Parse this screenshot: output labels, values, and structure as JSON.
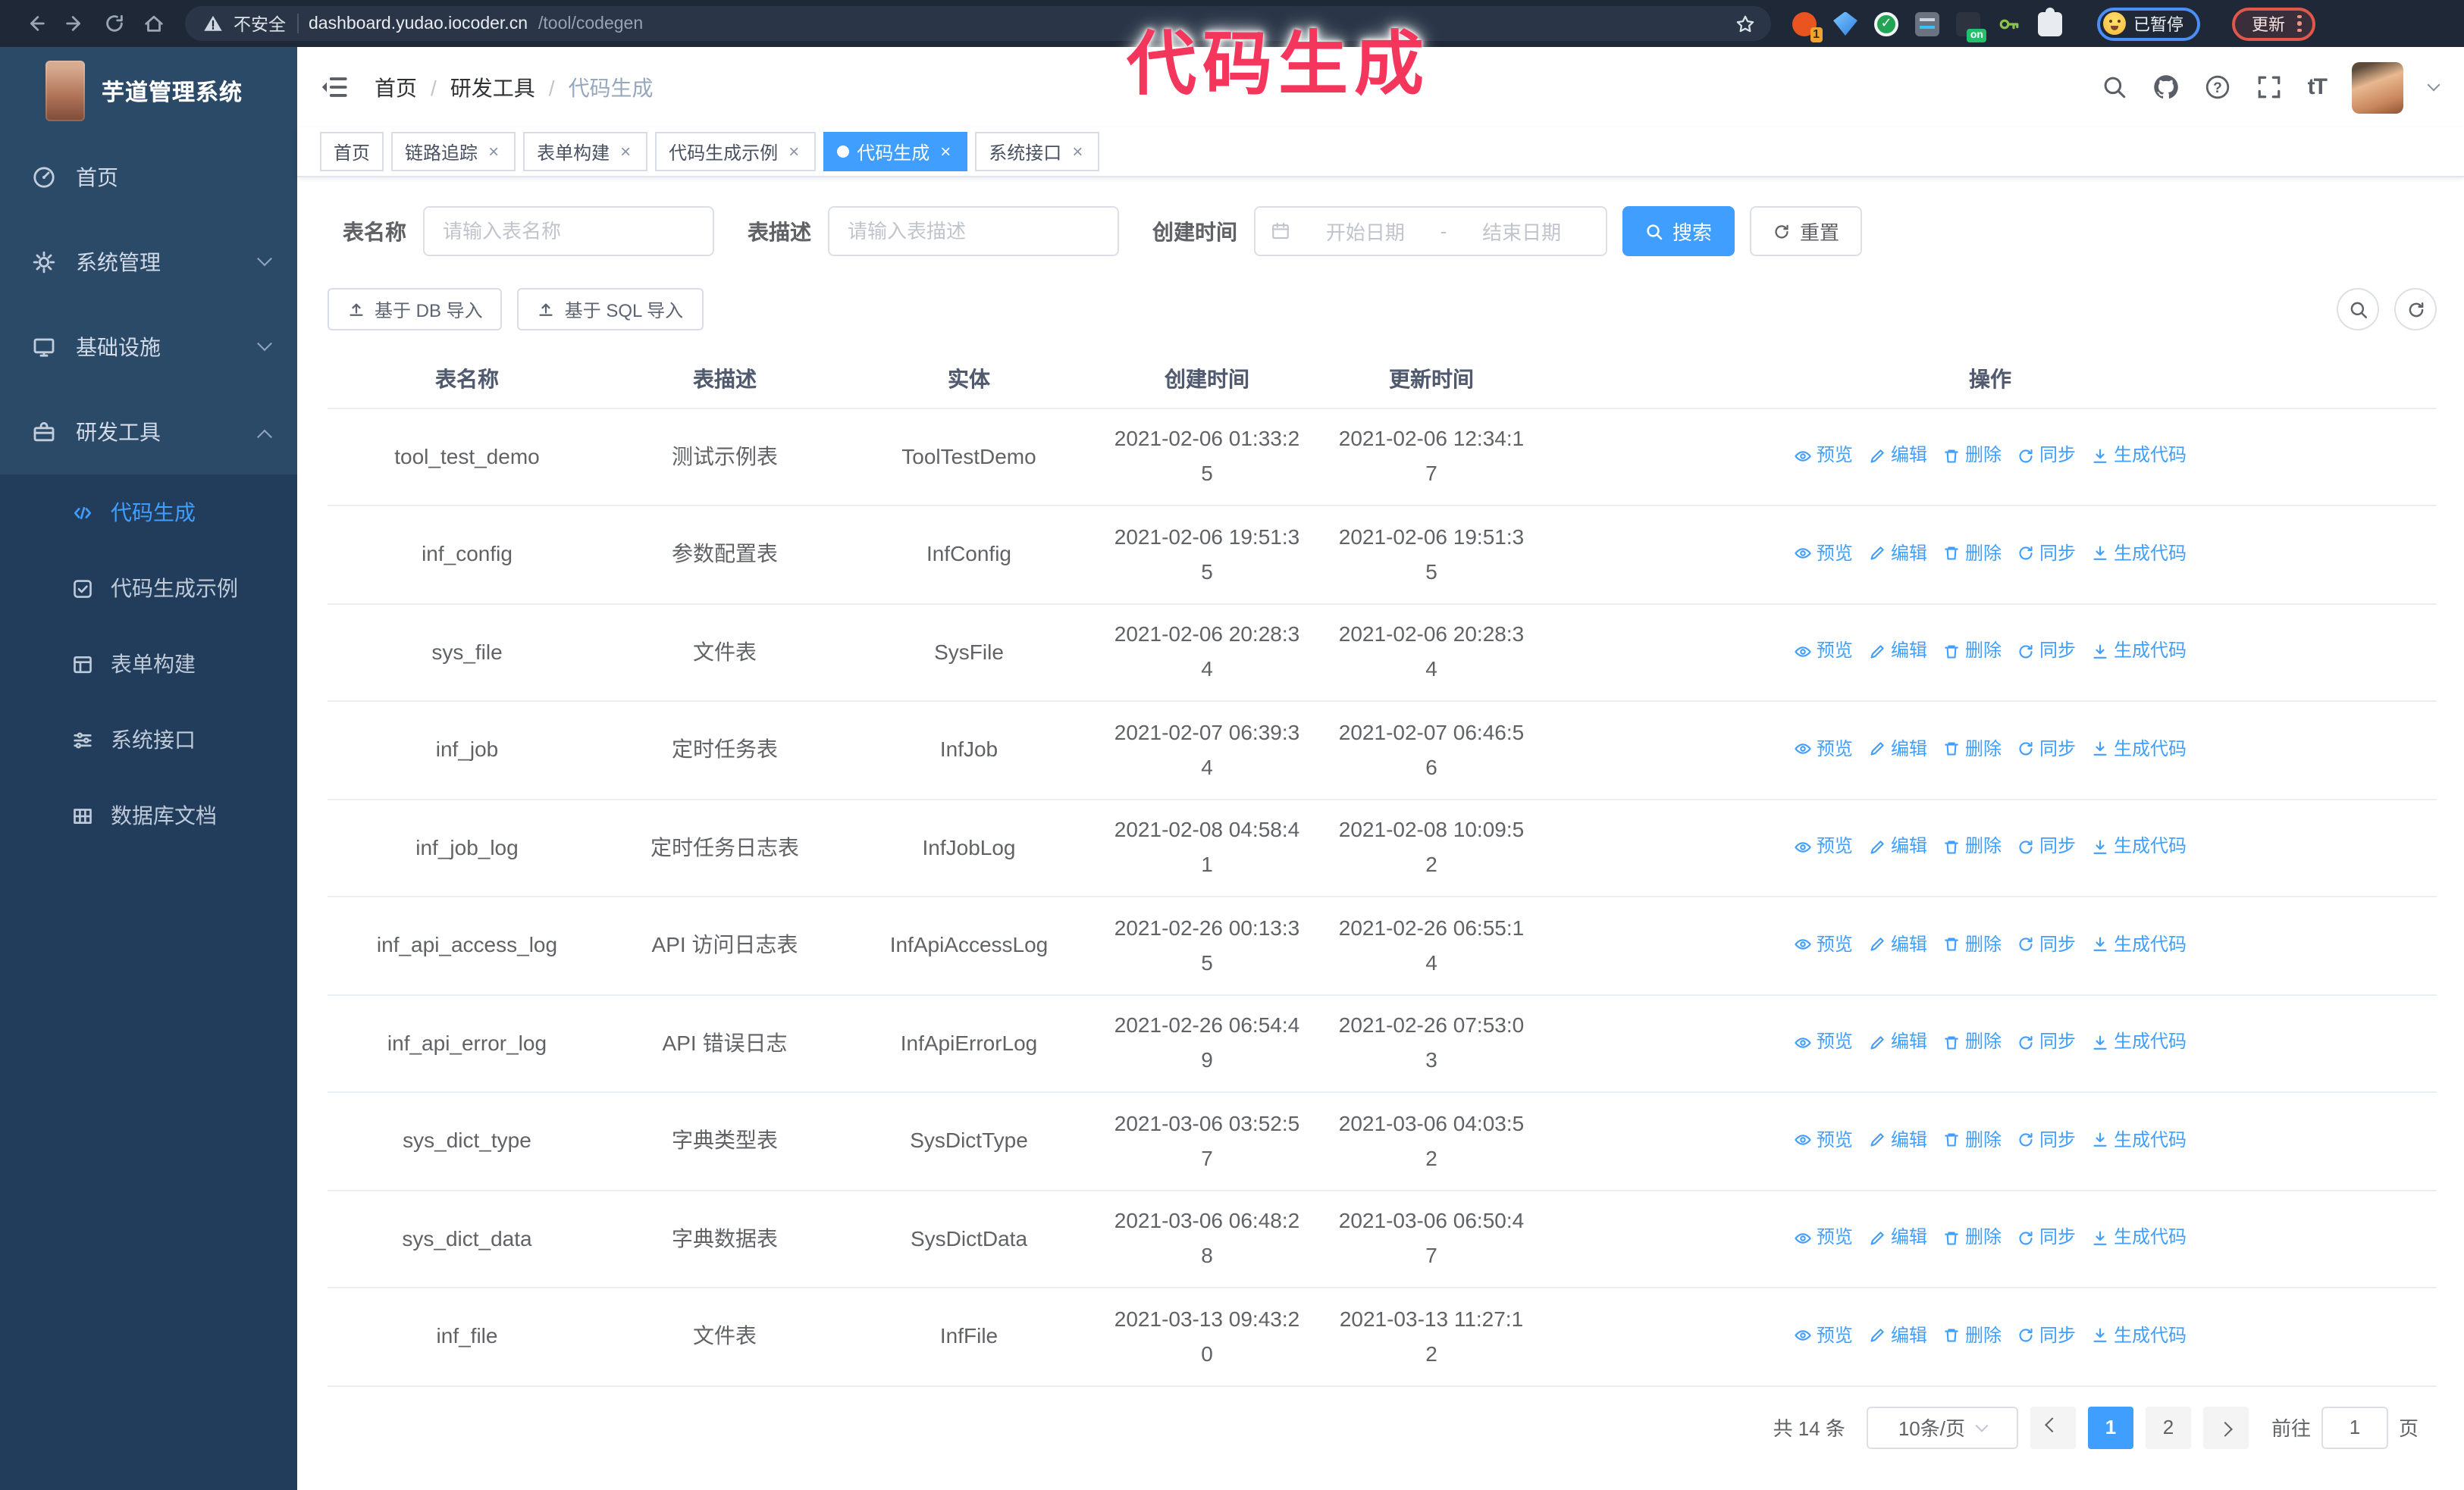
{
  "colors": {
    "accent": "#409eff",
    "annotation": "#f5365c",
    "sidebar_bg": "#2b4a68",
    "submenu_bg": "#223c5b",
    "chrome_bg": "#1e2836",
    "chrome_pill_bg": "#2a3647",
    "update_border": "#e2574c",
    "paused_border": "#4b8ef7"
  },
  "annotation": {
    "text": "代码生成"
  },
  "browser": {
    "security_label": "不安全",
    "url_host": "dashboard.yudao.iocoder.cn",
    "url_path": "/tool/codegen",
    "extension_badge": "1",
    "extension_on_badge": "on",
    "extension_check_glyph": "✓",
    "paused_chip": "已暂停",
    "update_button": "更新"
  },
  "sidebar": {
    "title": "芋道管理系统",
    "items": [
      {
        "id": "home",
        "label": "首页",
        "icon": "dashboard-icon",
        "chevron": null
      },
      {
        "id": "system",
        "label": "系统管理",
        "icon": "gear-icon",
        "chevron": "down"
      },
      {
        "id": "infra",
        "label": "基础设施",
        "icon": "monitor-icon",
        "chevron": "down"
      },
      {
        "id": "devtools",
        "label": "研发工具",
        "icon": "toolbox-icon",
        "chevron": "up"
      }
    ],
    "submenu": [
      {
        "id": "codegen",
        "label": "代码生成",
        "icon": "code-icon",
        "active": true
      },
      {
        "id": "codegen-example",
        "label": "代码生成示例",
        "icon": "example-icon",
        "active": false
      },
      {
        "id": "form-builder",
        "label": "表单构建",
        "icon": "form-icon",
        "active": false
      },
      {
        "id": "system-api",
        "label": "系统接口",
        "icon": "api-icon",
        "active": false
      },
      {
        "id": "db-doc",
        "label": "数据库文档",
        "icon": "db-doc-icon",
        "active": false
      }
    ]
  },
  "header": {
    "breadcrumb": [
      "首页",
      "研发工具",
      "代码生成"
    ],
    "breadcrumb_separator": "/",
    "font_size_glyph": "tT"
  },
  "tags": [
    {
      "label": "首页",
      "closable": false,
      "active": false
    },
    {
      "label": "链路追踪",
      "closable": true,
      "active": false
    },
    {
      "label": "表单构建",
      "closable": true,
      "active": false
    },
    {
      "label": "代码生成示例",
      "closable": true,
      "active": false
    },
    {
      "label": "代码生成",
      "closable": true,
      "active": true
    },
    {
      "label": "系统接口",
      "closable": true,
      "active": false
    }
  ],
  "search": {
    "name_label": "表名称",
    "name_placeholder": "请输入表名称",
    "desc_label": "表描述",
    "desc_placeholder": "请输入表描述",
    "time_label": "创建时间",
    "start_placeholder": "开始日期",
    "range_separator": "-",
    "end_placeholder": "结束日期",
    "search_label": "搜索",
    "reset_label": "重置"
  },
  "toolbar": {
    "db_import_label": "基于 DB 导入",
    "sql_import_label": "基于 SQL 导入"
  },
  "table": {
    "columns": [
      "表名称",
      "表描述",
      "实体",
      "创建时间",
      "更新时间",
      "操作"
    ],
    "actions": [
      "预览",
      "编辑",
      "删除",
      "同步",
      "生成代码"
    ],
    "rows": [
      {
        "name": "tool_test_demo",
        "desc": "测试示例表",
        "entity": "ToolTestDemo",
        "created": "2021-02-06 01:33:25",
        "updated": "2021-02-06 12:34:17"
      },
      {
        "name": "inf_config",
        "desc": "参数配置表",
        "entity": "InfConfig",
        "created": "2021-02-06 19:51:35",
        "updated": "2021-02-06 19:51:35"
      },
      {
        "name": "sys_file",
        "desc": "文件表",
        "entity": "SysFile",
        "created": "2021-02-06 20:28:34",
        "updated": "2021-02-06 20:28:34"
      },
      {
        "name": "inf_job",
        "desc": "定时任务表",
        "entity": "InfJob",
        "created": "2021-02-07 06:39:34",
        "updated": "2021-02-07 06:46:56"
      },
      {
        "name": "inf_job_log",
        "desc": "定时任务日志表",
        "entity": "InfJobLog",
        "created": "2021-02-08 04:58:41",
        "updated": "2021-02-08 10:09:52"
      },
      {
        "name": "inf_api_access_log",
        "desc": "API 访问日志表",
        "entity": "InfApiAccessLog",
        "created": "2021-02-26 00:13:35",
        "updated": "2021-02-26 06:55:14"
      },
      {
        "name": "inf_api_error_log",
        "desc": "API 错误日志",
        "entity": "InfApiErrorLog",
        "created": "2021-02-26 06:54:49",
        "updated": "2021-02-26 07:53:03"
      },
      {
        "name": "sys_dict_type",
        "desc": "字典类型表",
        "entity": "SysDictType",
        "created": "2021-03-06 03:52:57",
        "updated": "2021-03-06 04:03:52"
      },
      {
        "name": "sys_dict_data",
        "desc": "字典数据表",
        "entity": "SysDictData",
        "created": "2021-03-06 06:48:28",
        "updated": "2021-03-06 06:50:47"
      },
      {
        "name": "inf_file",
        "desc": "文件表",
        "entity": "InfFile",
        "created": "2021-03-13 09:43:20",
        "updated": "2021-03-13 11:27:12"
      }
    ]
  },
  "pagination": {
    "total": "共 14 条",
    "page_size": "10条/页",
    "pages": [
      "1",
      "2"
    ],
    "active_page": "1",
    "goto_label": "前往",
    "goto_value": "1",
    "page_suffix": "页"
  }
}
